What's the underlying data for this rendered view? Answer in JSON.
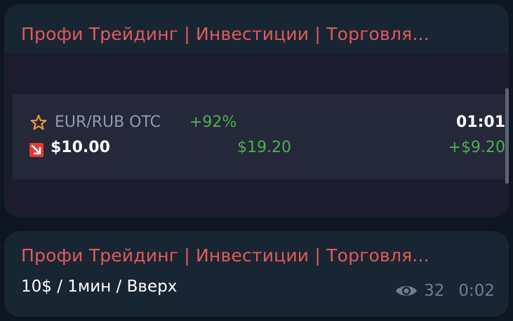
{
  "messages": [
    {
      "sender": "Профи Трейдинг | Инвестиции | Торговля...",
      "trade": {
        "pair": "EUR/RUB OTC",
        "percent": "+92%",
        "timer": "01:01",
        "amount": "$10.00",
        "payout": "$19.20",
        "profit": "+$9.20",
        "star_icon": "star-icon",
        "direction_icon": "arrow-down-right-icon"
      }
    },
    {
      "sender": "Профи Трейдинг | Инвестиции | Торговля...",
      "text": "10$ / 1мин / Вверх",
      "views": "32",
      "time": "0:02"
    }
  ],
  "colors": {
    "background": "#0e1621",
    "bubble": "#182533",
    "sender": "#e35a5a",
    "positive": "#4cb050",
    "star": "#e9983a",
    "down_arrow": "#e53935",
    "meta": "#6d7f8f"
  }
}
